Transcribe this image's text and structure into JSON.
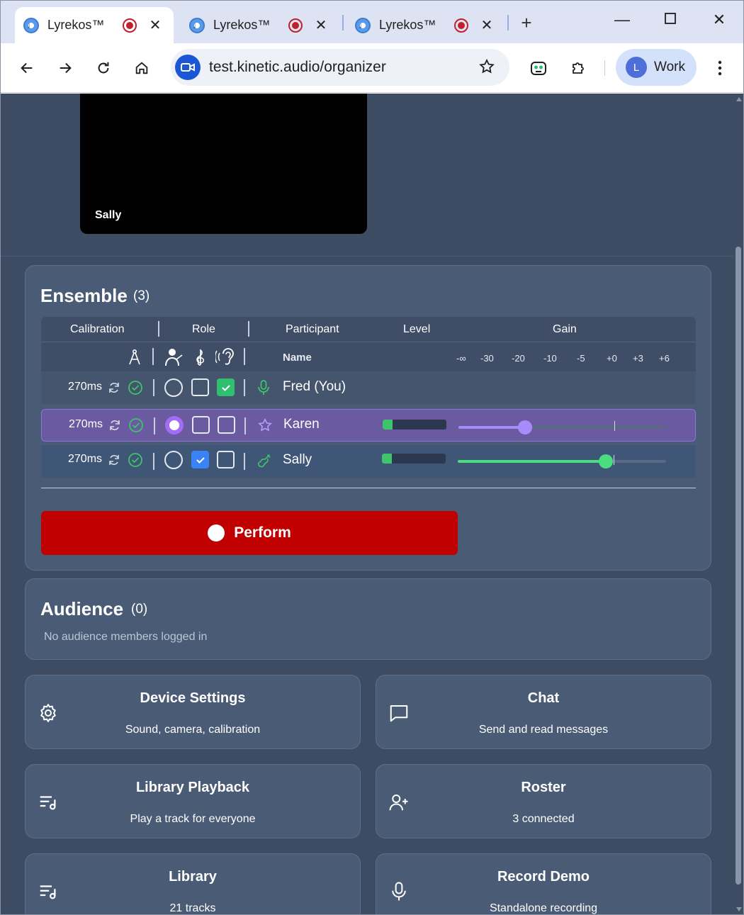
{
  "browser": {
    "tabs": [
      {
        "title": "Lyrekos™",
        "active": true
      },
      {
        "title": "Lyrekos™",
        "active": false
      },
      {
        "title": "Lyrekos™",
        "active": false
      }
    ],
    "new_tab": "+",
    "url": "test.kinetic.audio/organizer",
    "profile": {
      "initial": "L",
      "name": "Work"
    }
  },
  "video": {
    "name": "Sally"
  },
  "ensemble": {
    "title": "Ensemble",
    "count": "(3)",
    "headers": {
      "calibration": "Calibration",
      "role": "Role",
      "participant": "Participant",
      "level": "Level",
      "gain": "Gain"
    },
    "subheader_name": "Name",
    "gain_ticks": [
      "-∞",
      "-30",
      "-20",
      "-10",
      "-5",
      "+0",
      "+3",
      "+6"
    ],
    "rows": [
      {
        "latency": "270ms",
        "name": "Fred (You)",
        "role": "listener",
        "icon": "microphone-icon",
        "level": null,
        "gain": null
      },
      {
        "latency": "270ms",
        "name": "Karen",
        "role": "conductor",
        "icon": "star-icon",
        "level": 0.15,
        "gain": 0.32
      },
      {
        "latency": "270ms",
        "name": "Sally",
        "role": "musician",
        "icon": "guitar-icon",
        "level": 0.15,
        "gain": 0.71
      }
    ],
    "perform_label": "Perform"
  },
  "audience": {
    "title": "Audience",
    "count": "(0)",
    "empty_text": "No audience members logged in"
  },
  "tiles": {
    "device_settings": {
      "title": "Device Settings",
      "subtitle": "Sound, camera, calibration"
    },
    "chat": {
      "title": "Chat",
      "subtitle": "Send and read messages"
    },
    "library_playback": {
      "title": "Library Playback",
      "subtitle": "Play a track for everyone"
    },
    "roster": {
      "title": "Roster",
      "subtitle": "3 connected"
    },
    "library": {
      "title": "Library",
      "subtitle": "21 tracks"
    },
    "record_demo": {
      "title": "Record Demo",
      "subtitle": "Standalone recording"
    }
  },
  "colors": {
    "page_bg": "#3d4c63",
    "card_bg": "#4a5b75",
    "perform_red": "#c00000",
    "karen_purple": "#a78bfa",
    "sally_green": "#4ade80",
    "check_green": "#2fbf6f",
    "check_blue": "#3b82f6"
  }
}
